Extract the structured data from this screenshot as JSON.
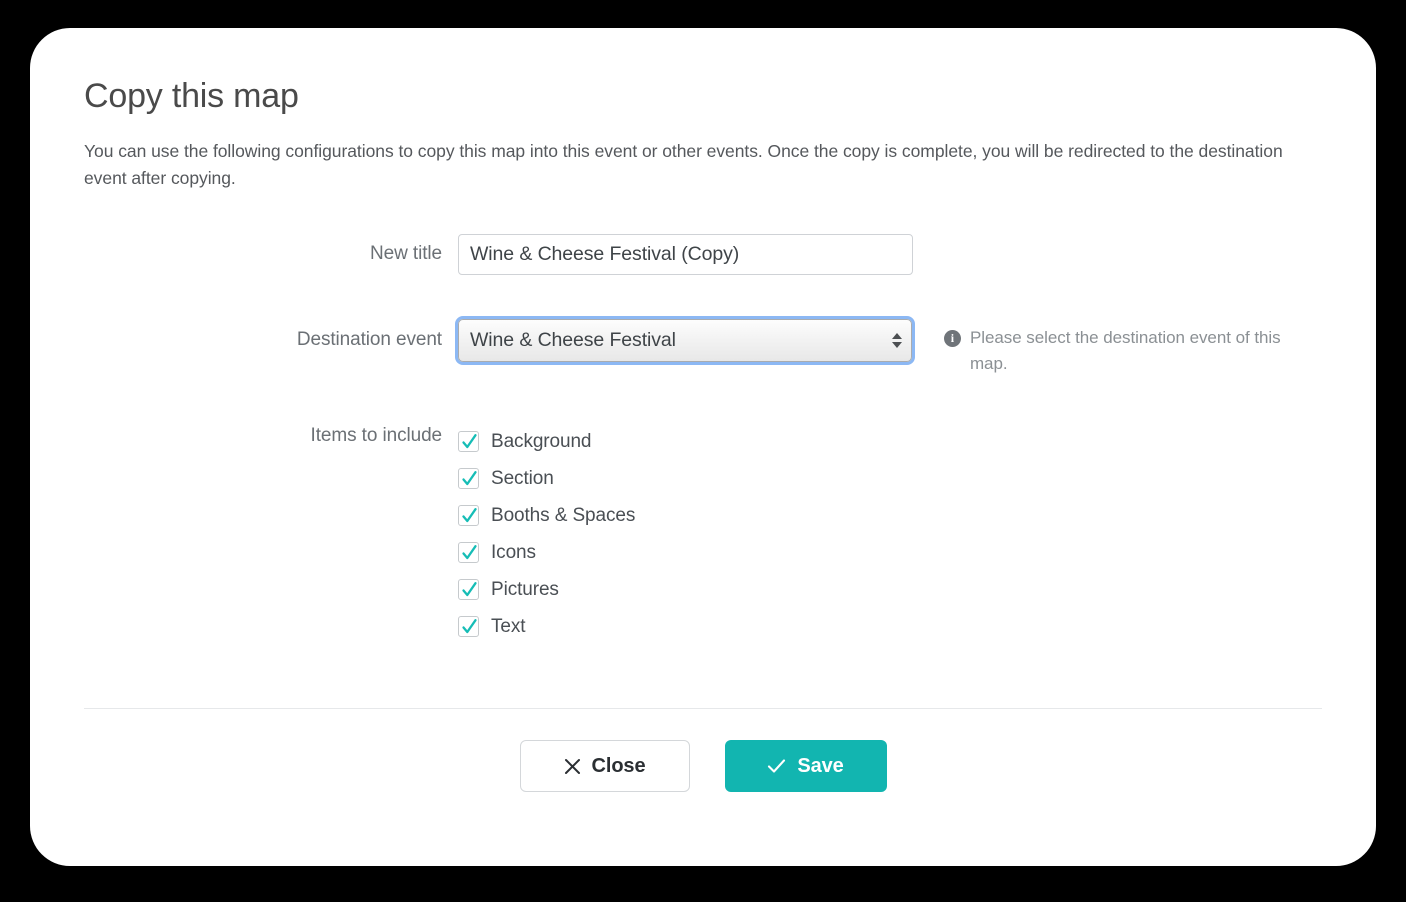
{
  "modal": {
    "title": "Copy this map",
    "description": "You can use the following configurations to copy this map into this event or other events. Once the copy is complete, you will be redirected to the destination event after copying."
  },
  "form": {
    "new_title": {
      "label": "New title",
      "value": "Wine & Cheese Festival (Copy)",
      "placeholder": "New title"
    },
    "destination_event": {
      "label": "Destination event",
      "selected": "Wine & Cheese Festival",
      "options": [
        "Wine & Cheese Festival"
      ],
      "help_text": "Please select the destination event of this map.",
      "help_icon": "info-icon"
    },
    "items_to_include": {
      "label": "Items to include",
      "items": [
        {
          "label": "Background",
          "checked": true
        },
        {
          "label": "Section",
          "checked": true
        },
        {
          "label": "Booths & Spaces",
          "checked": true
        },
        {
          "label": "Icons",
          "checked": true
        },
        {
          "label": "Pictures",
          "checked": true
        },
        {
          "label": "Text",
          "checked": true
        }
      ]
    }
  },
  "footer": {
    "close_label": "Close",
    "close_icon": "close-x-icon",
    "save_label": "Save",
    "save_icon": "check-icon"
  },
  "colors": {
    "accent_teal": "#12b5b0",
    "check_teal": "#16bdb6",
    "focus_blue": "#2d7deb",
    "title_gray": "#4a4a4a",
    "label_gray": "#6b7075",
    "help_gray": "#8b9094",
    "backdrop": "#000000",
    "card": "#ffffff"
  }
}
